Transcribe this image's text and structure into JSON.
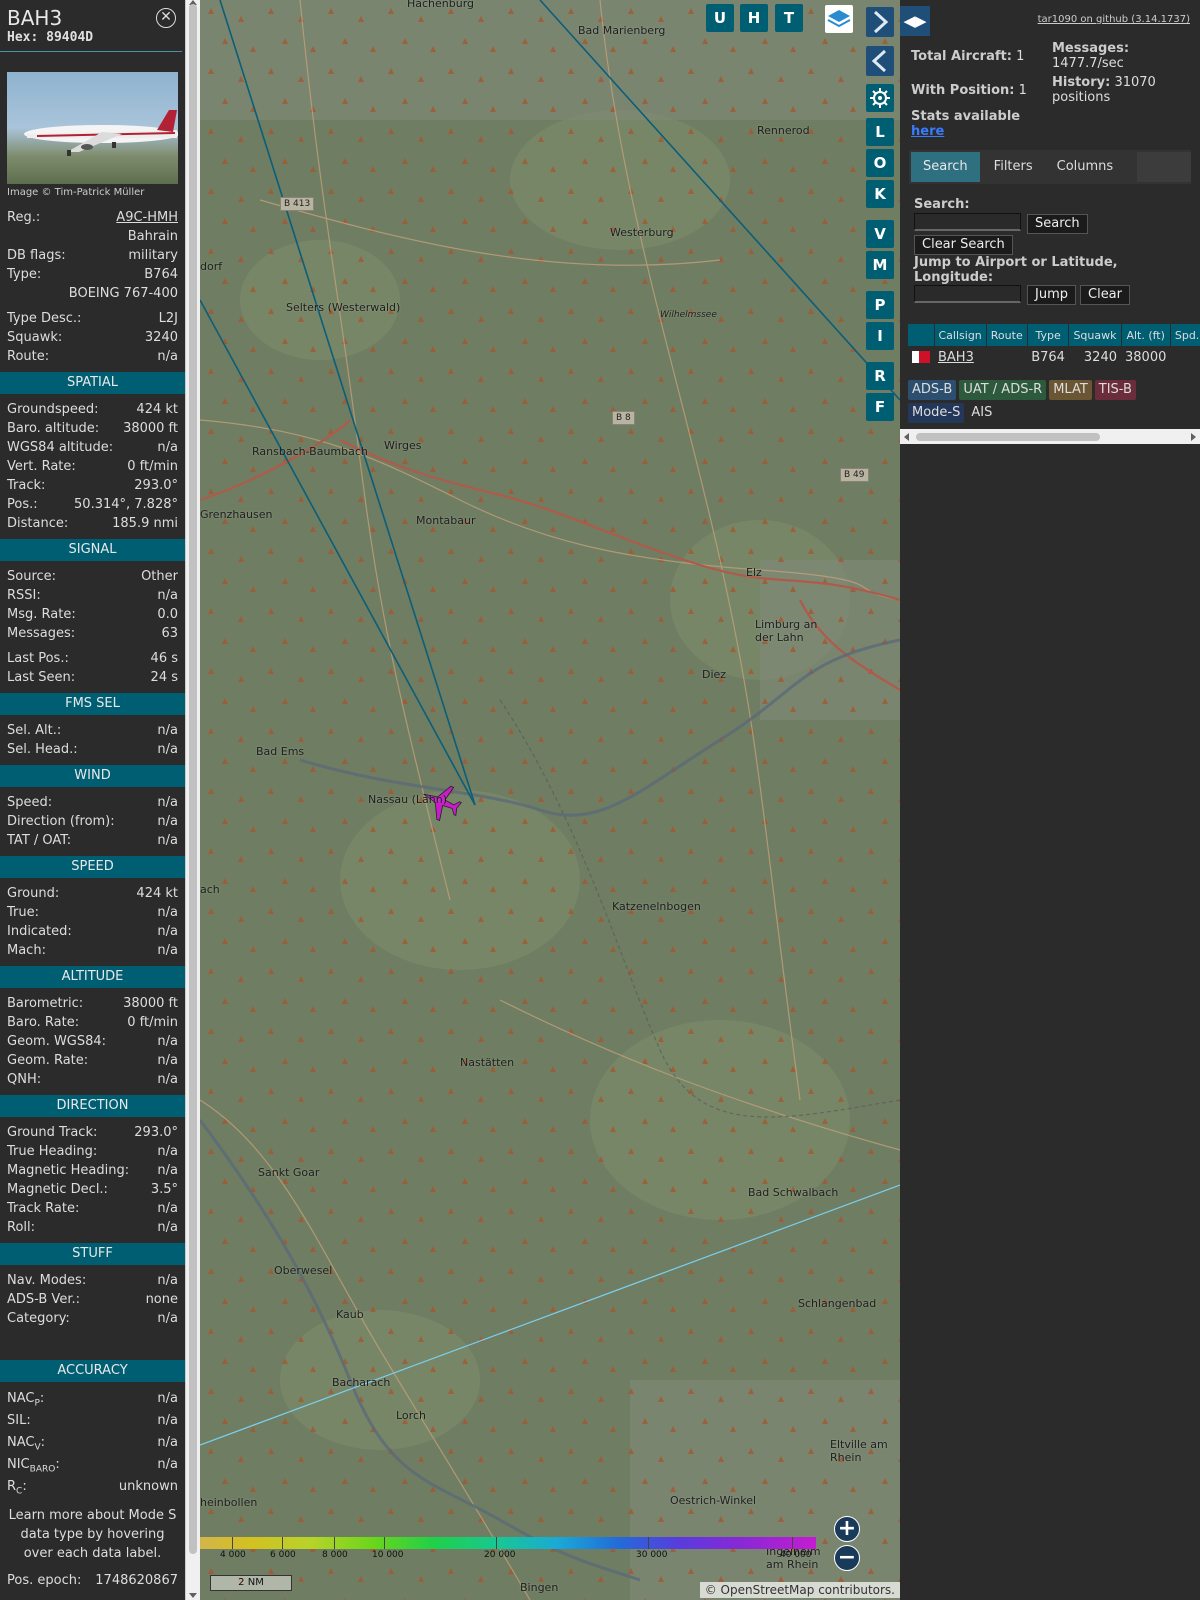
{
  "info": {
    "callsign": "BAH3",
    "hex": "Hex: 89404D",
    "photo_credit": "Image © Tim-Patrick Müller",
    "reg_label": "Reg.:",
    "reg_value": "A9C-HMH",
    "country": "Bahrain",
    "dbflags_label": "DB flags:",
    "dbflags_value": "military",
    "type_label": "Type:",
    "type_value": "B764",
    "type_full": "BOEING 767-400",
    "typedesc_label": "Type Desc.:",
    "typedesc_value": "L2J",
    "squawk_label": "Squawk:",
    "squawk_value": "3240",
    "route_label": "Route:",
    "route_value": "n/a"
  },
  "spatial": {
    "title": "SPATIAL",
    "rows": [
      {
        "k": "Groundspeed:",
        "v": "424 kt"
      },
      {
        "k": "Baro. altitude:",
        "v": "38000 ft"
      },
      {
        "k": "WGS84 altitude:",
        "v": "n/a"
      },
      {
        "k": "Vert. Rate:",
        "v": "0 ft/min"
      },
      {
        "k": "Track:",
        "v": "293.0°"
      },
      {
        "k": "Pos.:",
        "v": "50.314°, 7.828°"
      },
      {
        "k": "Distance:",
        "v": "185.9 nmi"
      }
    ]
  },
  "signal": {
    "title": "SIGNAL",
    "rows": [
      {
        "k": "Source:",
        "v": "Other"
      },
      {
        "k": "RSSI:",
        "v": "n/a"
      },
      {
        "k": "Msg. Rate:",
        "v": "0.0"
      },
      {
        "k": "Messages:",
        "v": "63"
      }
    ],
    "rows2": [
      {
        "k": "Last Pos.:",
        "v": "46 s"
      },
      {
        "k": "Last Seen:",
        "v": "24 s"
      }
    ]
  },
  "fms": {
    "title": "FMS SEL",
    "rows": [
      {
        "k": "Sel. Alt.:",
        "v": "n/a"
      },
      {
        "k": "Sel. Head.:",
        "v": "n/a"
      }
    ]
  },
  "wind": {
    "title": "WIND",
    "rows": [
      {
        "k": "Speed:",
        "v": "n/a"
      },
      {
        "k": "Direction (from):",
        "v": "n/a"
      },
      {
        "k": "TAT / OAT:",
        "v": "n/a"
      }
    ]
  },
  "speed": {
    "title": "SPEED",
    "rows": [
      {
        "k": "Ground:",
        "v": "424 kt"
      },
      {
        "k": "True:",
        "v": "n/a"
      },
      {
        "k": "Indicated:",
        "v": "n/a"
      },
      {
        "k": "Mach:",
        "v": "n/a"
      }
    ]
  },
  "altitude": {
    "title": "ALTITUDE",
    "rows": [
      {
        "k": "Barometric:",
        "v": "38000 ft"
      },
      {
        "k": "Baro. Rate:",
        "v": "0 ft/min"
      },
      {
        "k": "Geom. WGS84:",
        "v": "n/a"
      },
      {
        "k": "Geom. Rate:",
        "v": "n/a"
      },
      {
        "k": "QNH:",
        "v": "n/a"
      }
    ]
  },
  "direction": {
    "title": "DIRECTION",
    "rows": [
      {
        "k": "Ground Track:",
        "v": "293.0°"
      },
      {
        "k": "True Heading:",
        "v": "n/a"
      },
      {
        "k": "Magnetic Heading:",
        "v": "n/a"
      },
      {
        "k": "Magnetic Decl.:",
        "v": "3.5°"
      },
      {
        "k": "Track Rate:",
        "v": "n/a"
      },
      {
        "k": "Roll:",
        "v": "n/a"
      }
    ]
  },
  "stuff": {
    "title": "STUFF",
    "rows": [
      {
        "k": "Nav. Modes:",
        "v": "n/a"
      },
      {
        "k": "ADS-B Ver.:",
        "v": "none"
      },
      {
        "k": "Category:",
        "v": "n/a"
      }
    ]
  },
  "accuracy": {
    "title": "ACCURACY",
    "nacp_k": "NAC",
    "nacp_sub": "P",
    "nacp_v": "n/a",
    "sil_k": "SIL:",
    "sil_v": "n/a",
    "nacv_k": "NAC",
    "nacv_sub": "V",
    "nacv_v": "n/a",
    "nic_k": "NIC",
    "nic_sub": "BARO",
    "nic_v": "n/a",
    "rc_k": "R",
    "rc_sub": "C",
    "rc_v": "unknown",
    "learn": "Learn more about Mode S data type by hovering over each data label.",
    "epoch_k": "Pos. epoch:",
    "epoch_v": "1748620867"
  },
  "map": {
    "buttons_top": [
      "U",
      "H",
      "T"
    ],
    "buttons_side": [
      "L",
      "O",
      "K",
      "V",
      "M",
      "P",
      "I",
      "R",
      "F"
    ],
    "places": [
      {
        "t": "Hachenburg",
        "c": "hachenburg"
      },
      {
        "t": "Bad Marienberg",
        "c": "badmarienberg"
      },
      {
        "t": "Rennerod",
        "c": "rennerod"
      },
      {
        "t": "Westerburg",
        "c": "westerburg"
      },
      {
        "t": "dorf",
        "c": "dorf"
      },
      {
        "t": "Selters (Westerwald)",
        "c": "selters"
      },
      {
        "t": "Wilhelmssee",
        "c": "wilhelmssee"
      },
      {
        "t": "Ransbach-Baumbach",
        "c": "ransbach"
      },
      {
        "t": "Wirges",
        "c": "wirges"
      },
      {
        "t": "Grenzhausen",
        "c": "grenzhausen"
      },
      {
        "t": "Montabaur",
        "c": "montabaur"
      },
      {
        "t": "Elz",
        "c": "elz"
      },
      {
        "t": "Limburg an der Lahn",
        "c": "limburg"
      },
      {
        "t": "Diez",
        "c": "diez"
      },
      {
        "t": "Bad Ems",
        "c": "badems"
      },
      {
        "t": "Nassau (Lahn)",
        "c": "nassau"
      },
      {
        "t": "ach",
        "c": "ach"
      },
      {
        "t": "Katzenelnbogen",
        "c": "katzen"
      },
      {
        "t": "Nastätten",
        "c": "nastatten"
      },
      {
        "t": "Sankt Goar",
        "c": "goar"
      },
      {
        "t": "Bad Schwalbach",
        "c": "schwalbach"
      },
      {
        "t": "Oberwesel",
        "c": "oberwesel"
      },
      {
        "t": "Kaub",
        "c": "kaub"
      },
      {
        "t": "Schlangenbad",
        "c": "schlangenbad"
      },
      {
        "t": "Bacharach",
        "c": "bacharach"
      },
      {
        "t": "Lorch",
        "c": "lorch"
      },
      {
        "t": "Eltville am Rhein",
        "c": "eltville"
      },
      {
        "t": "Oestrich-Winkel",
        "c": "oestrich"
      },
      {
        "t": "heinbollen",
        "c": "heinbollen"
      },
      {
        "t": "Ingelheim am Rhein",
        "c": "ingelheim"
      },
      {
        "t": "Bingen",
        "c": "bingen"
      }
    ],
    "roads": [
      {
        "t": "B 413",
        "c": "b413"
      },
      {
        "t": "B 8",
        "c": "b8"
      },
      {
        "t": "B 49",
        "c": "b49"
      }
    ],
    "altitudes": [
      "4 000",
      "6 000",
      "8 000",
      "10 000",
      "20 000",
      "30 000",
      "40 000"
    ],
    "scale": "2 NM",
    "attribution_prefix": "© ",
    "attribution_link": "OpenStreetMap",
    "attribution_suffix": " contributors."
  },
  "sidebar": {
    "github": "tar1090 on github (3.14.1737)",
    "total_label": "Total Aircraft:",
    "total_value": "1",
    "withpos_label": "With Position:",
    "withpos_value": "1",
    "messages_label": "Messages:",
    "messages_value": "1477.7/sec",
    "history_label": "History:",
    "history_value": "31070 positions",
    "stats_label": "Stats available",
    "stats_link": "here",
    "tabs": [
      "Search",
      "Filters",
      "Columns"
    ],
    "search_label": "Search:",
    "search_btn": "Search",
    "clear_search_btn": "Clear Search",
    "jump_label": "Jump to Airport or Latitude, Longitude:",
    "jump_btn": "Jump",
    "clear_btn": "Clear",
    "columns": [
      "Callsign",
      "Route",
      "Type",
      "Squawk",
      "Alt. (ft)",
      "Spd."
    ],
    "row": {
      "callsign": "BAH3",
      "route": "",
      "type": "B764",
      "squawk": "3240",
      "alt": "38000"
    },
    "legend": [
      {
        "t": "ADS-B",
        "bg": "#2c4f6f",
        "fg": "#ddd"
      },
      {
        "t": "UAT / ADS-R",
        "bg": "#2d5a3c",
        "fg": "#ddd"
      },
      {
        "t": "MLAT",
        "bg": "#6b5634",
        "fg": "#ddd"
      },
      {
        "t": "TIS-B",
        "bg": "#6b2d3b",
        "fg": "#ddd"
      },
      {
        "t": "Mode-S",
        "bg": "#23375a",
        "fg": "#ddd"
      },
      {
        "t": "AIS",
        "bg": "transparent",
        "fg": "#ddd"
      }
    ]
  }
}
